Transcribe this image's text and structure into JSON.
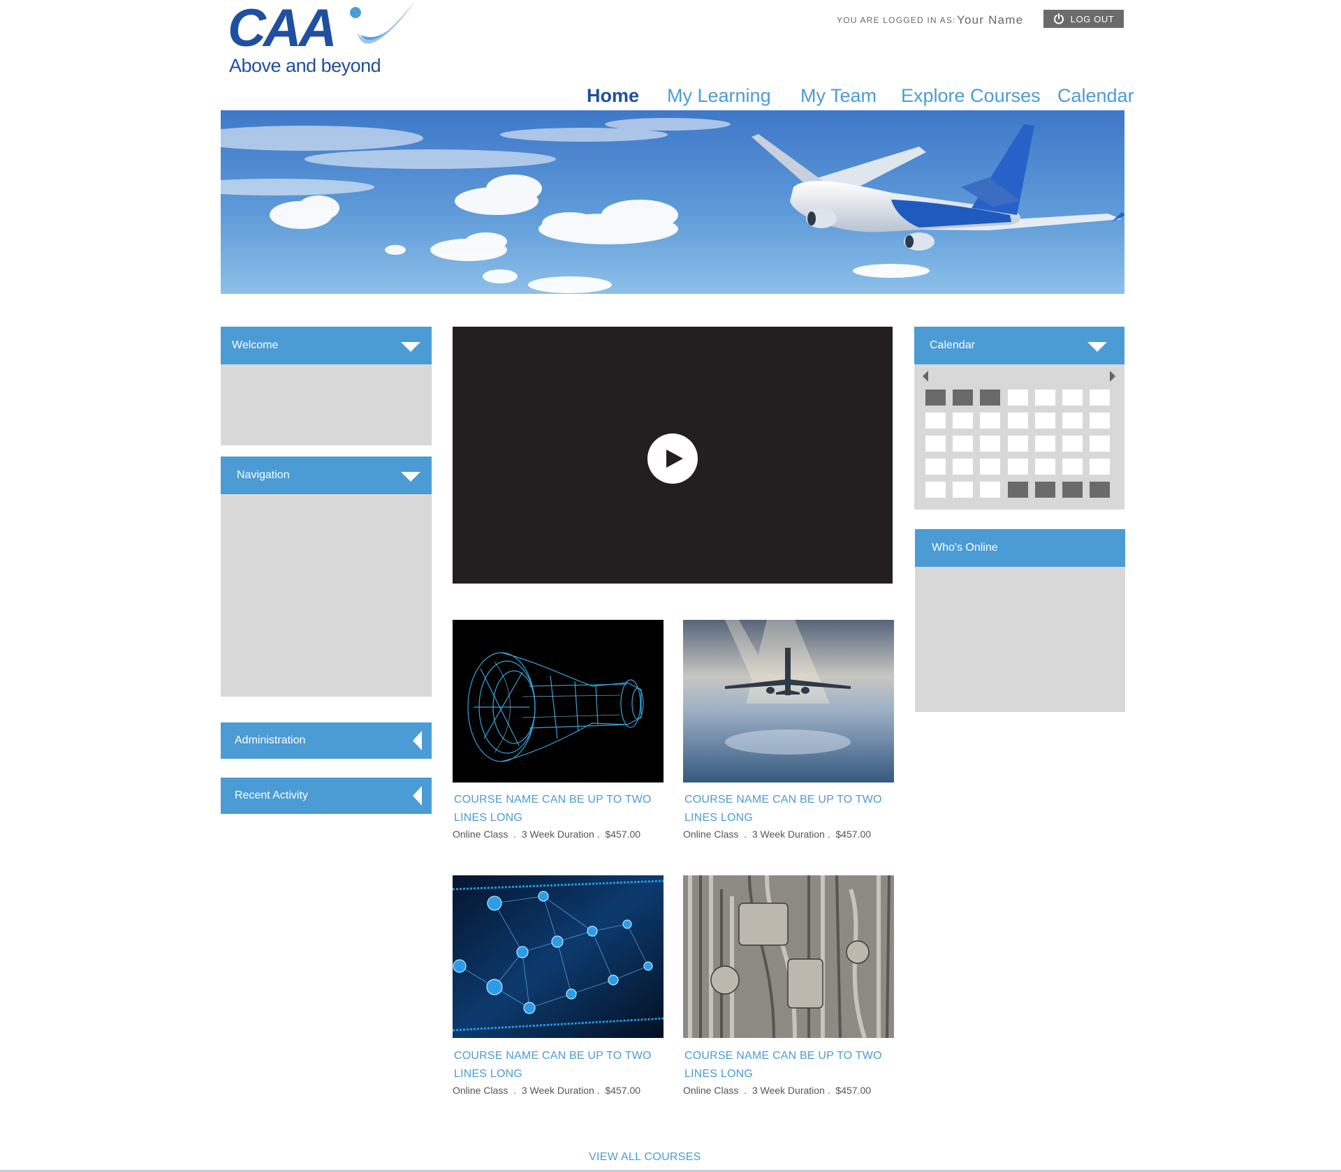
{
  "brand": {
    "logo_text": "CAA",
    "tagline": "Above and beyond",
    "colors": {
      "primary_dark": "#1f4fa1",
      "accent": "#4a9cd6",
      "panel_header": "#4b9bd4",
      "panel_body": "#d9d8d9"
    }
  },
  "user": {
    "logged_in_label": "YOU ARE LOGGED IN AS:",
    "name": "Your Name",
    "logout_label": "LOG OUT",
    "logout_icon": "power-icon"
  },
  "nav": {
    "items": [
      {
        "label": "Home",
        "active": true
      },
      {
        "label": "My Learning",
        "active": false
      },
      {
        "label": "My Team",
        "active": false
      },
      {
        "label": "Explore Courses",
        "active": false
      },
      {
        "label": "Calendar",
        "active": false
      }
    ]
  },
  "left_panels": {
    "welcome": {
      "title": "Welcome",
      "icon": "chevron-down-icon",
      "expanded": true
    },
    "navigation": {
      "title": "Navigation",
      "icon": "chevron-down-icon",
      "expanded": true
    },
    "administration": {
      "title": "Administration",
      "icon": "chevron-left-icon",
      "expanded": false
    },
    "recent_activity": {
      "title": "Recent Activity",
      "icon": "chevron-left-icon",
      "expanded": false
    }
  },
  "video": {
    "play_icon": "play-icon"
  },
  "courses": [
    {
      "title": "COURSE NAME CAN BE UP TO TWO LINES LONG",
      "type": "Online Class",
      "sep": ".",
      "duration": "3 Week Duration",
      "price": "$457.00",
      "image": "jet-engine-wireframe"
    },
    {
      "title": "COURSE NAME CAN BE UP TO TWO LINES LONG",
      "type": "Online Class",
      "sep": ".",
      "duration": "3 Week Duration",
      "price": "$457.00",
      "image": "airplane-over-sea"
    },
    {
      "title": "COURSE NAME CAN BE UP TO TWO LINES LONG",
      "type": "Online Class",
      "sep": ".",
      "duration": "3 Week Duration",
      "price": "$457.00",
      "image": "airplane-network-map"
    },
    {
      "title": "COURSE NAME CAN BE UP TO TWO LINES LONG",
      "type": "Online Class",
      "sep": ".",
      "duration": "3 Week Duration",
      "price": "$457.00",
      "image": "engine-machinery"
    }
  ],
  "view_all": "VIEW ALL COURSES",
  "right_panels": {
    "calendar": {
      "title": "Calendar",
      "icon": "chevron-down-icon",
      "prev_icon": "arrow-left-icon",
      "next_icon": "arrow-right-icon"
    },
    "whos_online": {
      "title": "Who's Online"
    }
  }
}
